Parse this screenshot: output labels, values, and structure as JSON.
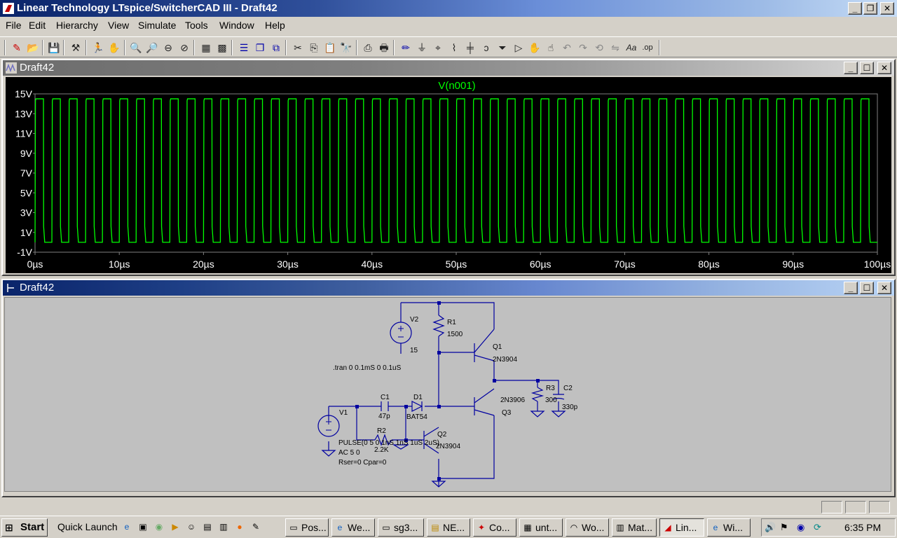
{
  "app": {
    "title": "Linear Technology LTspice/SwitcherCAD III - Draft42"
  },
  "menu": [
    "File",
    "Edit",
    "Hierarchy",
    "View",
    "Simulate",
    "Tools",
    "Window",
    "Help"
  ],
  "toolbar_icons": [
    "new-schematic",
    "open",
    "save",
    "control-panel",
    "run",
    "halt",
    "zoom-in",
    "zoom-pan",
    "zoom-out",
    "zoom-fit",
    "autorange",
    "plot-settings",
    "tile-vertical",
    "cascade",
    "close-all",
    "cut",
    "copy",
    "paste",
    "find",
    "print-preview",
    "print",
    "draw-wire",
    "ground",
    "label-net",
    "resistor",
    "capacitor",
    "inductor",
    "diode",
    "component",
    "move",
    "drag",
    "undo",
    "redo",
    "rotate",
    "mirror",
    "text",
    "spice-directive"
  ],
  "plot_window": {
    "title": "Draft42",
    "trace_label": "V(n001)",
    "trace_color": "#00ff00",
    "y_ticks": [
      "15V",
      "13V",
      "11V",
      "9V",
      "7V",
      "5V",
      "3V",
      "1V",
      "-1V"
    ],
    "x_ticks": [
      "0µs",
      "10µs",
      "20µs",
      "30µs",
      "40µs",
      "50µs",
      "60µs",
      "70µs",
      "80µs",
      "90µs",
      "100µs"
    ]
  },
  "chart_data": {
    "type": "line",
    "title": "V(n001)",
    "xlabel": "",
    "ylabel": "",
    "x_range_us": [
      0,
      100
    ],
    "ylim": [
      -1,
      15
    ],
    "series": [
      {
        "name": "V(n001)",
        "waveform": "square",
        "period_us": 2,
        "pulse_width_us": 1,
        "high_v": 14.5,
        "low_v": 0,
        "cycles": 50
      }
    ]
  },
  "schematic_window": {
    "title": "Draft42",
    "labels": {
      "v2_name": "V2",
      "v2_value": "15",
      "r1_name": "R1",
      "r1_value": "1500",
      "q1_name": "Q1",
      "q1_model": "2N3904",
      "tran": ".tran 0 0.1mS 0 0.1uS",
      "q3_model": "2N3906",
      "q3_name": "Q3",
      "r3_name": "R3",
      "r3_value": "300",
      "c2_name": "C2",
      "c2_value": "330p",
      "c1_name": "C1",
      "c1_value": "47p",
      "d1_name": "D1",
      "d1_value": "BAT54",
      "v1_name": "V1",
      "r2_name": "R2",
      "r2_value": "2.2K",
      "q2_name": "Q2",
      "q2_model": "2N3904",
      "pulse": "PULSE(0 5 0 1nS 1nS 1uS 2uS)",
      "ac": "AC 5 0",
      "rser": "Rser=0 Cpar=0"
    }
  },
  "taskbar": {
    "start": "Start",
    "quick_launch": "Quick Launch",
    "tasks": [
      "Pos...",
      "We...",
      "sg3...",
      "NE...",
      "Co...",
      "unt...",
      "Wo...",
      "Mat...",
      "Lin...",
      "Wi..."
    ],
    "clock": "6:35 PM"
  }
}
